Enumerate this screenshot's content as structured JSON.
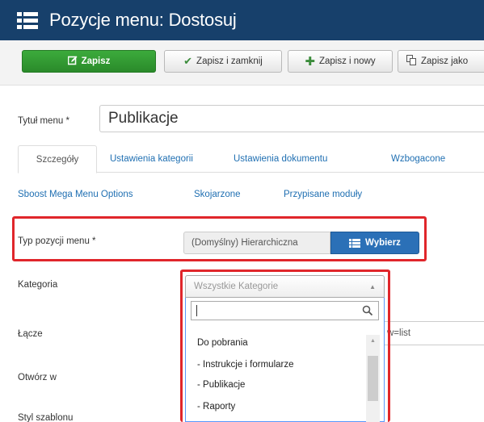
{
  "header": {
    "title": "Pozycje menu: Dostosuj",
    "icon": "list-icon"
  },
  "toolbar": {
    "save": "Zapisz",
    "save_close": "Zapisz i zamknij",
    "save_new": "Zapisz i nowy",
    "save_copy": "Zapisz jako"
  },
  "form": {
    "title_label": "Tytuł menu *",
    "title_value": "Publikacje",
    "type_label": "Typ pozycji menu *",
    "type_value": "(Domyślny) Hierarchiczna",
    "choose_button": "Wybierz",
    "category_label": "Kategoria",
    "link_label": "Łącze",
    "link_value": "w=list",
    "open_label": "Otwórz w",
    "style_label": "Styl szablonu"
  },
  "tabs": [
    "Szczegóły",
    "Ustawienia kategorii",
    "Ustawienia dokumentu",
    "Wzbogacone",
    "Sboost Mega Menu Options",
    "Skojarzone",
    "Przypisane moduły"
  ],
  "category_select": {
    "selected": "Wszystkie Kategorie",
    "search_value": "",
    "options": [
      "Do pobrania",
      "- Instrukcje i formularze",
      "- Publikacje",
      "- Raporty"
    ]
  },
  "colors": {
    "header_bg": "#17406b",
    "save_green": "#2e962e",
    "primary_blue": "#2b70b7",
    "link_blue": "#1f6fb2",
    "highlight_red": "#e0262b"
  }
}
